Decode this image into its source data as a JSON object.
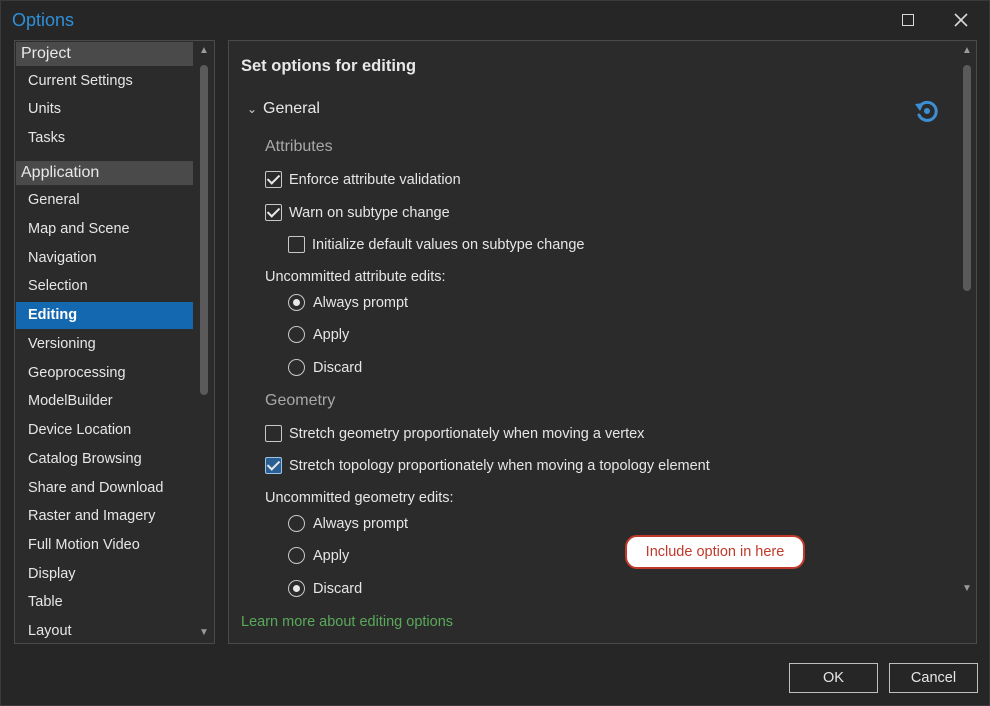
{
  "window": {
    "title": "Options"
  },
  "sidebar": {
    "project_header": "Project",
    "project_items": [
      "Current Settings",
      "Units",
      "Tasks"
    ],
    "application_header": "Application",
    "application_items": [
      "General",
      "Map and Scene",
      "Navigation",
      "Selection",
      "Editing",
      "Versioning",
      "Geoprocessing",
      "ModelBuilder",
      "Device Location",
      "Catalog Browsing",
      "Share and Download",
      "Raster and Imagery",
      "Full Motion Video",
      "Display",
      "Table",
      "Layout"
    ],
    "selected": "Editing"
  },
  "main": {
    "heading": "Set options for editing",
    "group_label": "General",
    "attributes": {
      "header": "Attributes",
      "enforce_validation": {
        "label": "Enforce attribute validation",
        "checked": true
      },
      "warn_subtype": {
        "label": "Warn on subtype change",
        "checked": true
      },
      "init_defaults": {
        "label": "Initialize default values on subtype change",
        "checked": false
      },
      "uncommitted_label": "Uncommitted attribute edits:",
      "radios": [
        "Always prompt",
        "Apply",
        "Discard"
      ],
      "selected_radio": "Always prompt"
    },
    "geometry": {
      "header": "Geometry",
      "stretch_geometry": {
        "label": "Stretch geometry proportionately when moving a vertex",
        "checked": false
      },
      "stretch_topology": {
        "label": "Stretch topology proportionately when moving a topology element",
        "checked": true
      },
      "uncommitted_label": "Uncommitted geometry edits:",
      "radios": [
        "Always prompt",
        "Apply",
        "Discard"
      ],
      "selected_radio": "Discard"
    },
    "callout_text": "Include option in here",
    "learn_more": "Learn more about editing options"
  },
  "footer": {
    "ok_label": "OK",
    "cancel_label": "Cancel"
  },
  "colors": {
    "accent": "#1468b0",
    "title": "#2f8fd8",
    "link": "#5aa95a",
    "callout": "#c0392b"
  }
}
